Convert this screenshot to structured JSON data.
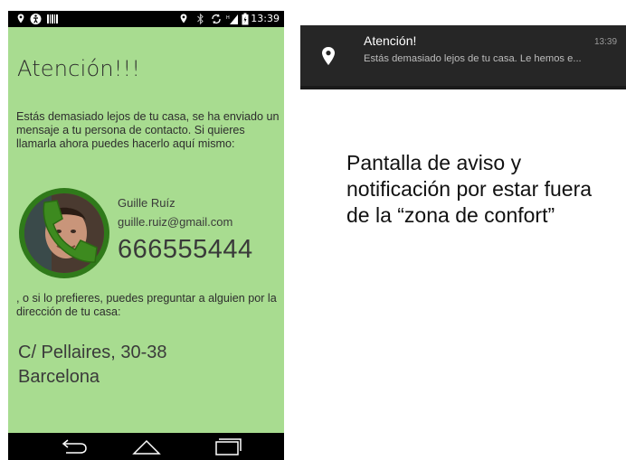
{
  "status_bar": {
    "time": "13:39",
    "left_icons": [
      "location-icon",
      "accessibility-icon",
      "barcode-icon"
    ],
    "right_icons": [
      "location-icon",
      "bluetooth-icon",
      "sync-icon",
      "signal-icon",
      "battery-icon"
    ]
  },
  "alert": {
    "title": "Atención!!!",
    "message": "Estás demasiado lejos de tu casa, se ha enviado un mensaje a tu persona de contacto. Si quieres llamarla ahora puedes hacerlo aquí mismo:",
    "contact": {
      "name": "Guille Ruíz",
      "email": "guille.ruiz@gmail.com",
      "phone": "666555444",
      "avatar_icon": "phone-icon"
    },
    "alt_message": ", o si lo prefieres, puedes preguntar a alguien por la dirección de tu casa:",
    "address_line1": "C/ Pellaires, 30-38",
    "address_line2": "Barcelona"
  },
  "nav_bar": {
    "buttons": [
      "back-icon",
      "home-icon",
      "recents-icon"
    ]
  },
  "notification": {
    "icon": "location-pin-icon",
    "title": "Atención!",
    "time": "13:39",
    "text": "Estás demasiado lejos de tu casa. Le hemos e..."
  },
  "caption": {
    "line1": "Pantalla de aviso y",
    "line2": "notificación por estar fuera",
    "line3": "de la “zona de confort”"
  },
  "colors": {
    "screen_bg": "#a8dc90",
    "avatar_ring": "#2f7a1a",
    "phone_icon": "#3d8a1f",
    "notification_bg": "#262626"
  }
}
